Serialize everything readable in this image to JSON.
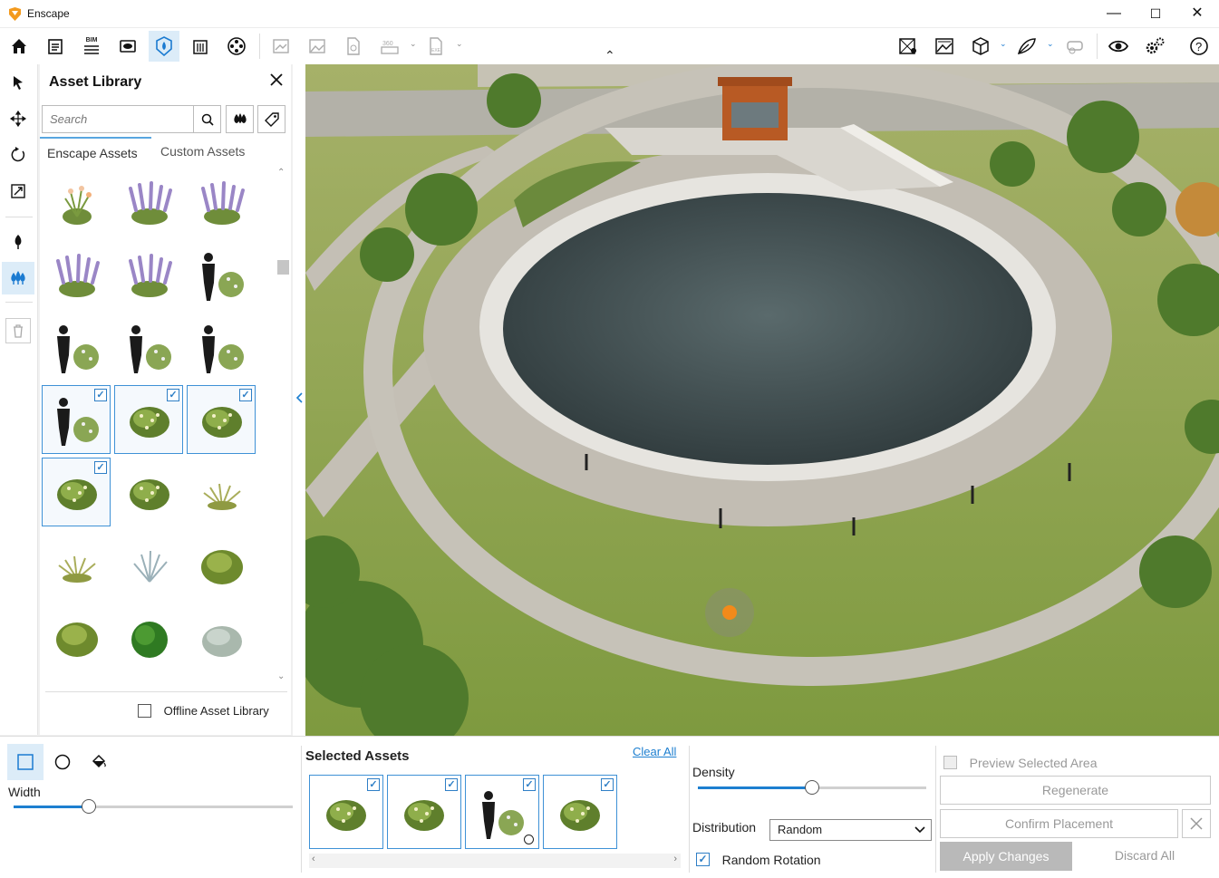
{
  "window": {
    "title": "Enscape",
    "minimize": "—",
    "maximize": "☐",
    "close": "✕"
  },
  "toolbar": {
    "home_icon": "home-icon",
    "notes_icon": "notes-icon",
    "bim_label": "BIM",
    "collapse_caret": "⌃"
  },
  "left_tools": [
    "select-arrow-icon",
    "move-icon",
    "rotate-icon",
    "scale-icon",
    "tree-icon",
    "forest-brush-icon",
    "trash-icon"
  ],
  "asset_library": {
    "title": "Asset Library",
    "search_placeholder": "Search",
    "tabs": [
      "Enscape Assets",
      "Custom Assets"
    ],
    "offline_label": "Offline Asset Library",
    "selected_cells": [
      9,
      10,
      11,
      12
    ]
  },
  "brush": {
    "width_label": "Width",
    "width_value": 0.27
  },
  "selected_assets": {
    "title": "Selected Assets",
    "clear_all": "Clear All"
  },
  "density": {
    "label": "Density",
    "value": 0.5
  },
  "distribution": {
    "label": "Distribution",
    "value": "Random"
  },
  "random_rotation": {
    "label": "Random Rotation",
    "checked": true
  },
  "actions": {
    "preview_label": "Preview Selected Area",
    "regenerate": "Regenerate",
    "confirm": "Confirm Placement",
    "apply": "Apply Changes",
    "discard": "Discard All"
  },
  "colors": {
    "accent": "#1d7fd0",
    "selection": "#3e91d6",
    "marker": "#f28a1a",
    "apply_bg": "#b9b9b9"
  }
}
